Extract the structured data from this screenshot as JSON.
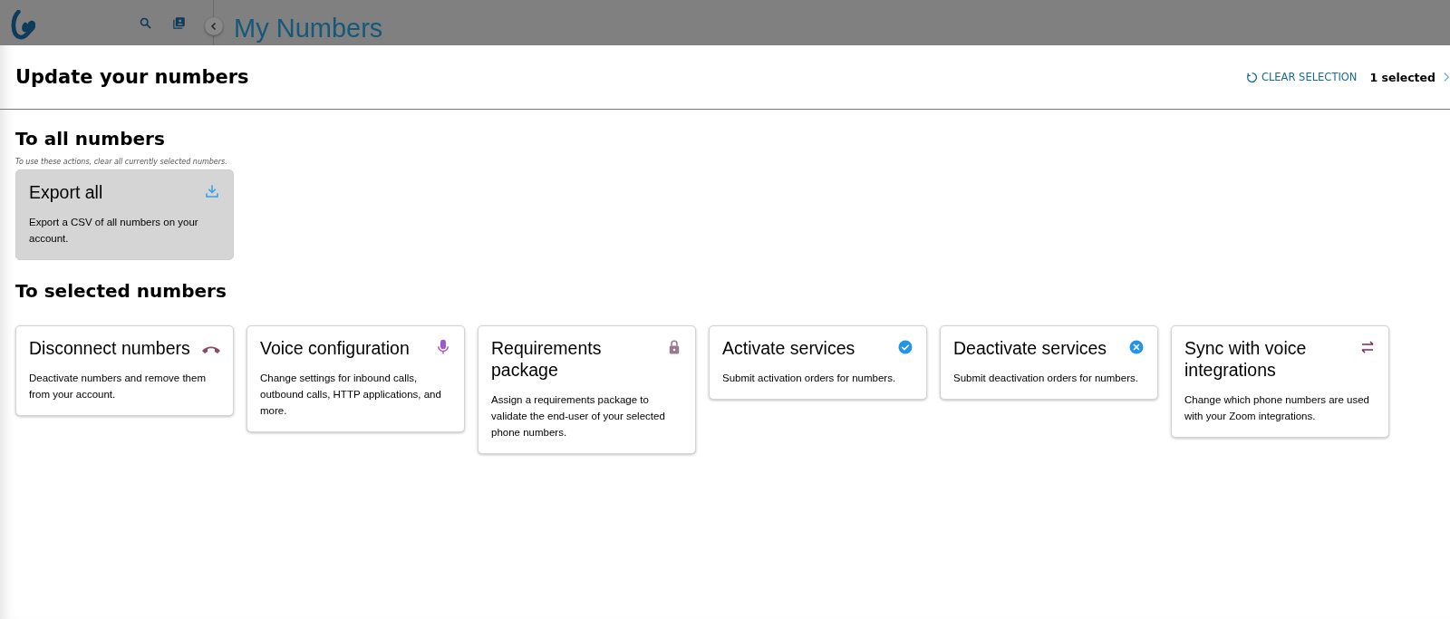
{
  "top_bar": {
    "title": "My Numbers"
  },
  "panel": {
    "title": "Update your numbers",
    "clear_button": "CLEAR SELECTION",
    "selection_count": "1 selected"
  },
  "all_section": {
    "heading": "To all numbers",
    "note": "To use these actions, clear all currently selected numbers.",
    "cards": [
      {
        "kind": "export",
        "title": "Export all",
        "description": "Export a CSV of all numbers on your account.",
        "disabled": true
      }
    ]
  },
  "selected_section": {
    "heading": "To selected numbers",
    "cards": [
      {
        "kind": "disconnect",
        "title": "Disconnect numbers",
        "description": "Deactivate numbers and remove them from your account.",
        "disabled": false
      },
      {
        "kind": "voice",
        "title": "Voice configuration",
        "description": "Change settings for inbound calls, outbound calls, HTTP applications, and more.",
        "disabled": false
      },
      {
        "kind": "requirements",
        "title": "Requirements package",
        "description": "Assign a requirements package to validate the end-user of your selected phone numbers.",
        "disabled": false
      },
      {
        "kind": "activate",
        "title": "Activate services",
        "description": "Submit activation orders for numbers.",
        "disabled": false
      },
      {
        "kind": "deactivate",
        "title": "Deactivate services",
        "description": "Submit deactivation orders for numbers.",
        "disabled": false
      },
      {
        "kind": "sync",
        "title": "Sync with voice integrations",
        "description": "Change which phone numbers are used with your Zoom integrations.",
        "disabled": false
      }
    ]
  }
}
